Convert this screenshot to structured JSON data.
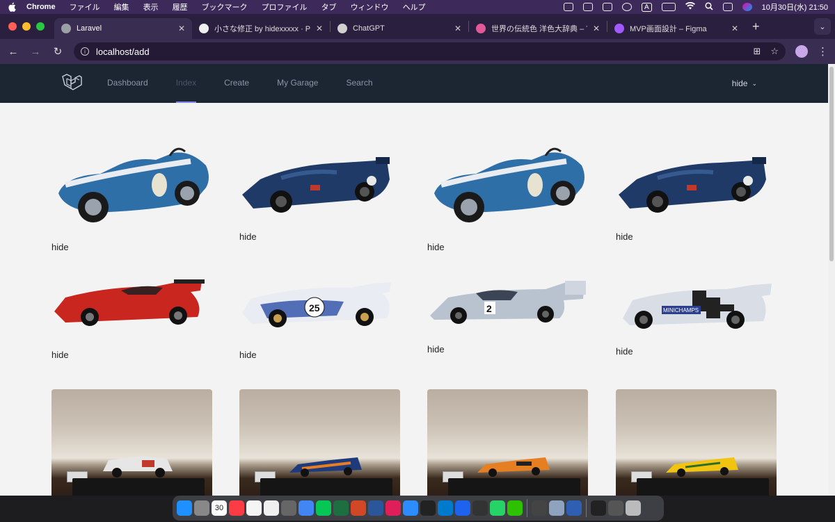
{
  "menubar": {
    "app": "Chrome",
    "items": [
      "ファイル",
      "編集",
      "表示",
      "履歴",
      "ブックマーク",
      "プロファイル",
      "タブ",
      "ウィンドウ",
      "ヘルプ"
    ],
    "clock": "10月30日(水) 21:50",
    "input_indicator": "A"
  },
  "tabs": [
    {
      "title": "Laravel",
      "active": true,
      "favicon_color": "#9aa0a6"
    },
    {
      "title": "小さな修正 by hidexxxxx · Pull",
      "active": false,
      "favicon_color": "#f0f0f0"
    },
    {
      "title": "ChatGPT",
      "active": false,
      "favicon_color": "#d0d0d0"
    },
    {
      "title": "世界の伝統色 洋色大辞典 – Tradi",
      "active": false,
      "favicon_color": "#e05a9a"
    },
    {
      "title": "MVP画面設計 – Figma",
      "active": false,
      "favicon_color": "#a259ff"
    }
  ],
  "toolbar": {
    "url": "localhost/add"
  },
  "app_nav": {
    "links": [
      {
        "label": "Dashboard",
        "active": false
      },
      {
        "label": "Index",
        "active": true
      },
      {
        "label": "Create",
        "active": false
      },
      {
        "label": "My Garage",
        "active": false
      },
      {
        "label": "Search",
        "active": false
      }
    ],
    "user": "hide"
  },
  "cars": [
    {
      "owner": "hide",
      "kind": "cobra",
      "color": "#2f6fa8"
    },
    {
      "owner": "hide",
      "kind": "lmp",
      "color": "#1f3a66"
    },
    {
      "owner": "hide",
      "kind": "cobra",
      "color": "#2f6fa8"
    },
    {
      "owner": "hide",
      "kind": "lmp",
      "color": "#1f3a66"
    },
    {
      "owner": "hide",
      "kind": "gt",
      "color": "#c8261e"
    },
    {
      "owner": "hide",
      "kind": "gt",
      "color": "#e9ecf3"
    },
    {
      "owner": "hide",
      "kind": "proto",
      "color": "#b9c2cf"
    },
    {
      "owner": "hide",
      "kind": "gt",
      "color": "#d8dde6"
    }
  ],
  "photos": [
    {
      "color": "#e6e6e6"
    },
    {
      "color": "#1e3a7a"
    },
    {
      "color": "#e67e22"
    },
    {
      "color": "#f1c40f"
    }
  ],
  "dock": {
    "calendar_day": "30",
    "icon_colors": [
      "#1e90ff",
      "#888888",
      "#ffffff",
      "#fc3c44",
      "#f5f5f5",
      "#f0f0f0",
      "#666666",
      "#4285f4",
      "#06c755",
      "#1d6f42",
      "#d24726",
      "#2b579a",
      "#e01e5a",
      "#2d8cff",
      "#222222",
      "#007acc",
      "#1d63ed",
      "#333333",
      "#25d366",
      "#2dc100",
      "#444444",
      "#8fa3bf",
      "#2f5fb3",
      "#222222",
      "#555555",
      "#bbbbbb"
    ]
  }
}
